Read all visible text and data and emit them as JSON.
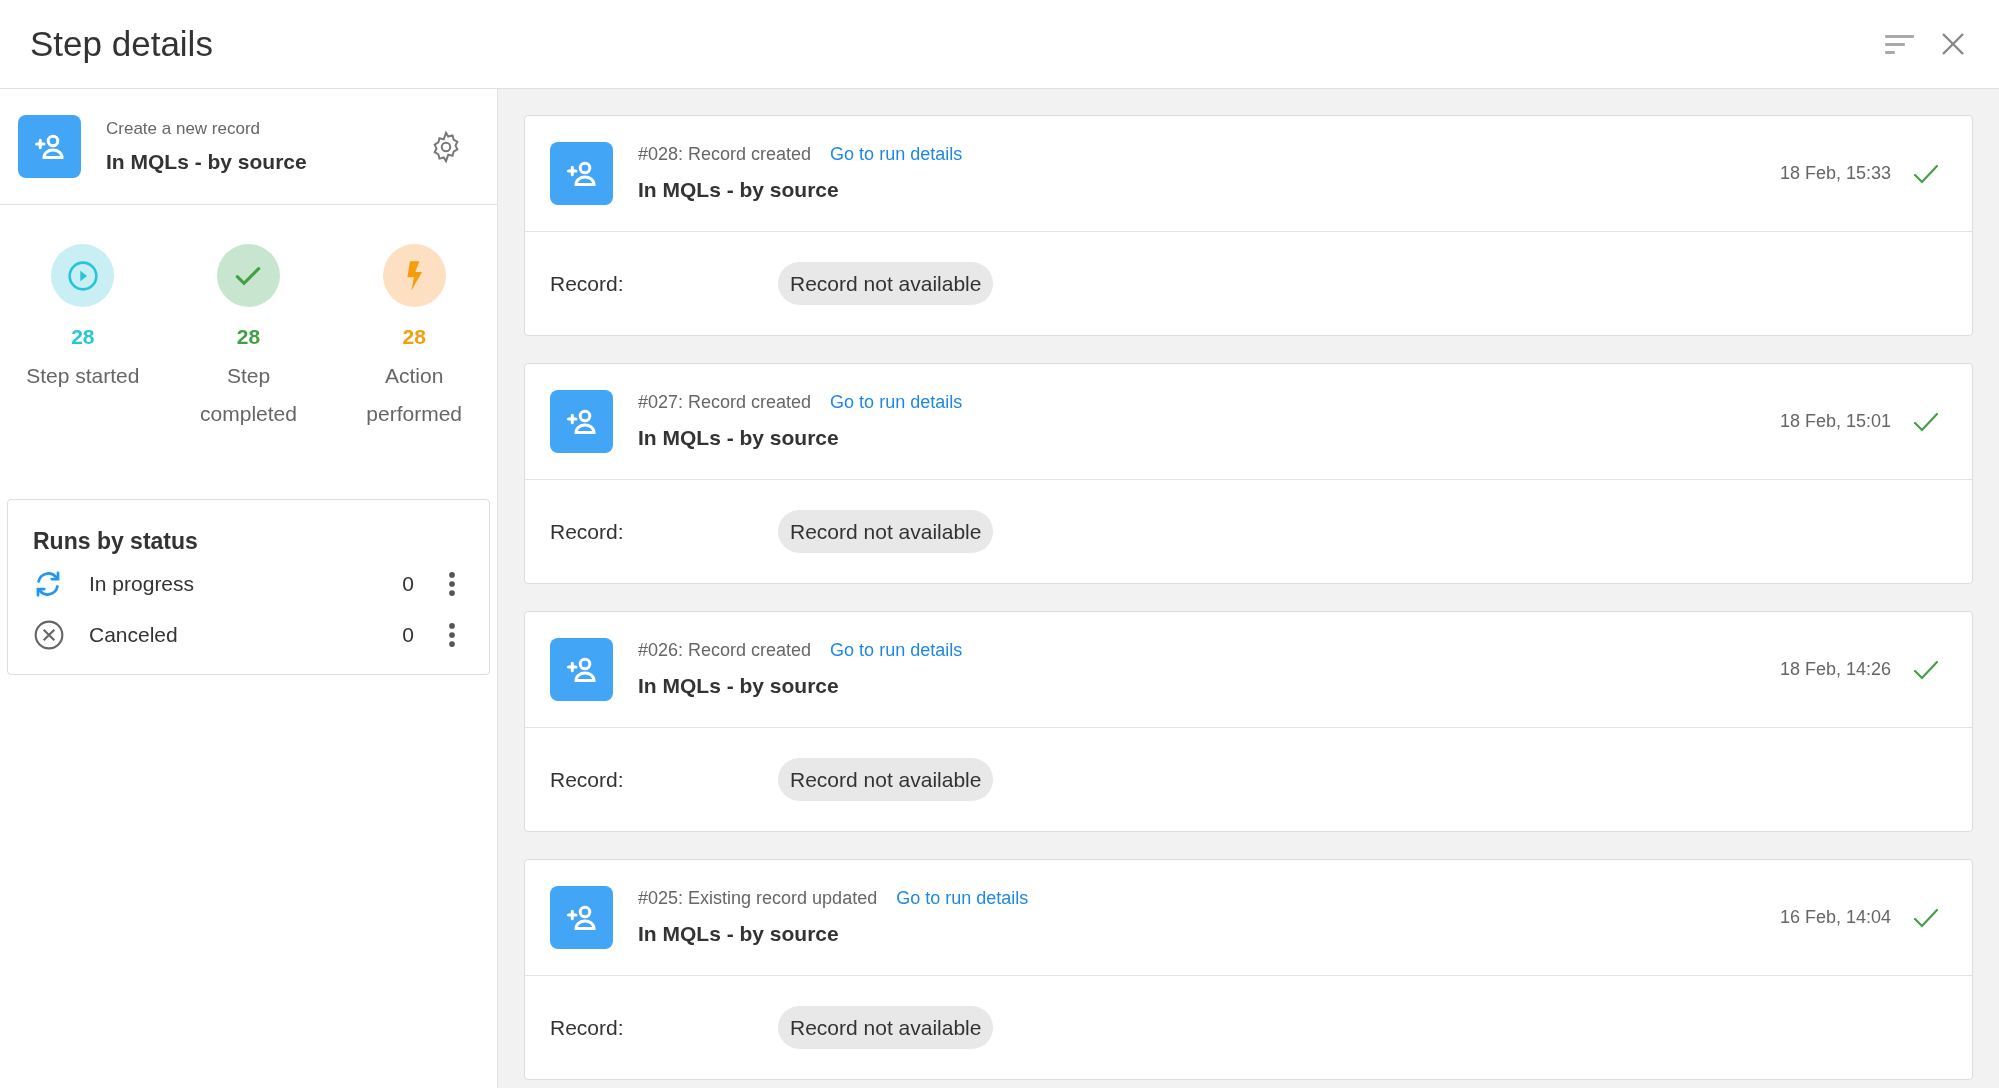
{
  "header": {
    "title": "Step details"
  },
  "step": {
    "subtitle": "Create a new record",
    "name": "In MQLs - by source"
  },
  "stats": [
    {
      "kind": "started",
      "count": "28",
      "label": "Step started",
      "color": "#26c6da"
    },
    {
      "kind": "completed",
      "count": "28",
      "label": "Step completed",
      "color": "#43a047"
    },
    {
      "kind": "performed",
      "count": "28",
      "label": "Action performed",
      "color": "#f59e0b"
    }
  ],
  "runs_by_status": {
    "title": "Runs by status",
    "items": [
      {
        "kind": "in_progress",
        "label": "In progress",
        "count": "0"
      },
      {
        "kind": "canceled",
        "label": "Canceled",
        "count": "0"
      }
    ]
  },
  "runs": [
    {
      "summary": "#028: Record created",
      "link": "Go to run details",
      "name": "In MQLs - by source",
      "time": "18 Feb, 15:33",
      "record_label": "Record:",
      "record_value": "Record not available"
    },
    {
      "summary": "#027: Record created",
      "link": "Go to run details",
      "name": "In MQLs - by source",
      "time": "18 Feb, 15:01",
      "record_label": "Record:",
      "record_value": "Record not available"
    },
    {
      "summary": "#026: Record created",
      "link": "Go to run details",
      "name": "In MQLs - by source",
      "time": "18 Feb, 14:26",
      "record_label": "Record:",
      "record_value": "Record not available"
    },
    {
      "summary": "#025: Existing record updated",
      "link": "Go to run details",
      "name": "In MQLs - by source",
      "time": "16 Feb, 14:04",
      "record_label": "Record:",
      "record_value": "Record not available"
    }
  ]
}
